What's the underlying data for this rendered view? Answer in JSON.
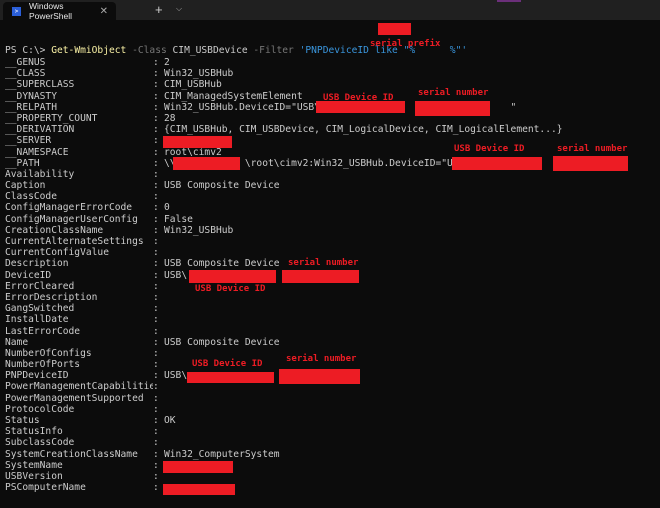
{
  "tab": {
    "title": "Windows PowerShell",
    "close": "✕",
    "new_tab": "+",
    "dropdown": "⌵"
  },
  "command": {
    "prompt": "PS C:\\> ",
    "cmdlet": "Get-WmiObject",
    "param_class": " -Class ",
    "class_value": "CIM_USBDevice",
    "param_filter": " -Filter ",
    "filter_start": "'PNPDeviceID like \"%",
    "filter_end": "%\"'"
  },
  "annotations": {
    "serial_prefix": "serial prefix",
    "usb_device_id": "USB Device ID",
    "serial_number": "serial number"
  },
  "properties": [
    {
      "key": "__GENUS",
      "value": "2"
    },
    {
      "key": "__CLASS",
      "value": "Win32_USBHub"
    },
    {
      "key": "__SUPERCLASS",
      "value": "CIM_USBHub"
    },
    {
      "key": "__DYNASTY",
      "value": "CIM_ManagedSystemElement"
    },
    {
      "key": "__RELPATH",
      "value": "Win32_USBHub.DeviceID=\"USB\\\\                \\\\              \""
    },
    {
      "key": "__PROPERTY_COUNT",
      "value": "28"
    },
    {
      "key": "__DERIVATION",
      "value": "{CIM_USBHub, CIM_USBDevice, CIM_LogicalDevice, CIM_LogicalElement...}"
    },
    {
      "key": "__SERVER",
      "value": ""
    },
    {
      "key": "__NAMESPACE",
      "value": "root\\cimv2"
    },
    {
      "key": "__PATH",
      "value": "\\\\            \\root\\cimv2:Win32_USBHub.DeviceID=\"USB\\\\                \\\\              \""
    },
    {
      "key": "Availability",
      "value": ""
    },
    {
      "key": "Caption",
      "value": "USB Composite Device"
    },
    {
      "key": "ClassCode",
      "value": ""
    },
    {
      "key": "ConfigManagerErrorCode",
      "value": "0"
    },
    {
      "key": "ConfigManagerUserConfig",
      "value": "False"
    },
    {
      "key": "CreationClassName",
      "value": "Win32_USBHub"
    },
    {
      "key": "CurrentAlternateSettings",
      "value": ""
    },
    {
      "key": "CurrentConfigValue",
      "value": ""
    },
    {
      "key": "Description",
      "value": "USB Composite Device"
    },
    {
      "key": "DeviceID",
      "value": "USB\\"
    },
    {
      "key": "ErrorCleared",
      "value": ""
    },
    {
      "key": "ErrorDescription",
      "value": ""
    },
    {
      "key": "GangSwitched",
      "value": ""
    },
    {
      "key": "InstallDate",
      "value": ""
    },
    {
      "key": "LastErrorCode",
      "value": ""
    },
    {
      "key": "Name",
      "value": "USB Composite Device"
    },
    {
      "key": "NumberOfConfigs",
      "value": ""
    },
    {
      "key": "NumberOfPorts",
      "value": ""
    },
    {
      "key": "PNPDeviceID",
      "value": "USB\\"
    },
    {
      "key": "PowerManagementCapabilities",
      "value": ""
    },
    {
      "key": "PowerManagementSupported",
      "value": ""
    },
    {
      "key": "ProtocolCode",
      "value": ""
    },
    {
      "key": "Status",
      "value": "OK"
    },
    {
      "key": "StatusInfo",
      "value": ""
    },
    {
      "key": "SubclassCode",
      "value": ""
    },
    {
      "key": "SystemCreationClassName",
      "value": "Win32_ComputerSystem"
    },
    {
      "key": "SystemName",
      "value": ""
    },
    {
      "key": "USBVersion",
      "value": ""
    },
    {
      "key": "PSComputerName",
      "value": ""
    }
  ],
  "colors": {
    "redaction": "#ed1c24",
    "background": "#0c0c0c",
    "cmdlet": "#f9f1a5",
    "string": "#3a96dd"
  }
}
